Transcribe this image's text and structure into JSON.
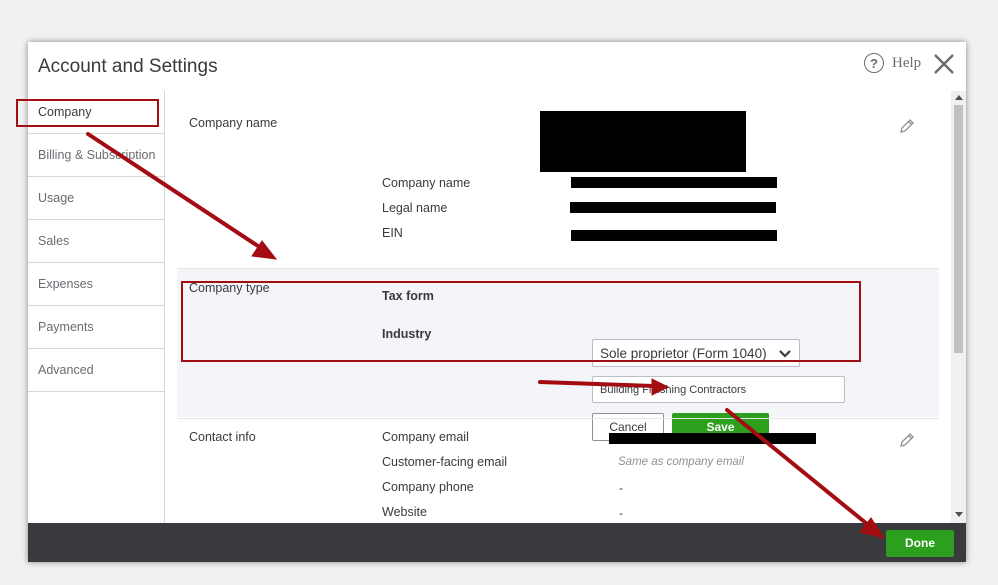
{
  "dialog": {
    "title": "Account and Settings",
    "help_label": "Help",
    "help_glyph": "?"
  },
  "sidebar": {
    "items": [
      {
        "label": "Company"
      },
      {
        "label": "Billing & Subscription"
      },
      {
        "label": "Usage"
      },
      {
        "label": "Sales"
      },
      {
        "label": "Expenses"
      },
      {
        "label": "Payments"
      },
      {
        "label": "Advanced"
      }
    ]
  },
  "company_name_section": {
    "label": "Company name",
    "fields": {
      "company_name": "Company name",
      "legal_name": "Legal name",
      "ein": "EIN"
    }
  },
  "company_type_section": {
    "label": "Company type",
    "tax_form_label": "Tax form",
    "tax_form_value": "Sole proprietor (Form 1040)",
    "industry_label": "Industry",
    "industry_value": "Building Finishing Contractors",
    "cancel_label": "Cancel",
    "save_label": "Save"
  },
  "contact_section": {
    "label": "Contact info",
    "company_email_label": "Company email",
    "customer_email_label": "Customer-facing email",
    "customer_email_value": "Same as company email",
    "phone_label": "Company phone",
    "phone_value": "-",
    "website_label": "Website",
    "website_value": "-"
  },
  "footer": {
    "done_label": "Done"
  },
  "colors": {
    "annotation_red": "#a30d12",
    "primary_green": "#2ca01c",
    "footer_dark": "#393a3d"
  },
  "icons": {
    "help": "help-circle-icon",
    "close": "close-icon",
    "edit": "pencil-icon",
    "dropdown": "chevron-down-icon"
  }
}
